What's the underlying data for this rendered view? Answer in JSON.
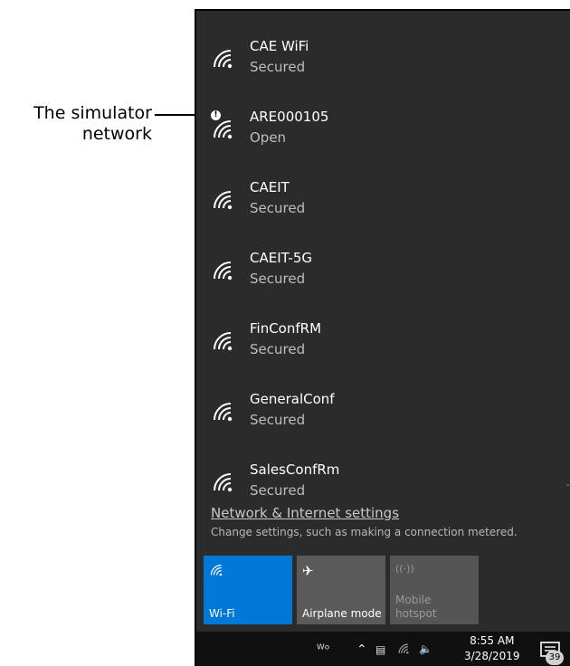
{
  "callout": {
    "line1": "The simulator",
    "line2": "network"
  },
  "networks": [
    {
      "name": "CAE WiFi",
      "status": "Secured"
    },
    {
      "name": "ARE000105",
      "status": "Open"
    },
    {
      "name": "CAEIT",
      "status": "Secured"
    },
    {
      "name": "CAEIT-5G",
      "status": "Secured"
    },
    {
      "name": "FinConfRM",
      "status": "Secured"
    },
    {
      "name": "GeneralConf",
      "status": "Secured"
    },
    {
      "name": "SalesConfRm",
      "status": "Secured"
    }
  ],
  "settings": {
    "link": "Network & Internet settings",
    "description": "Change settings, such as making a connection metered."
  },
  "quick_actions": {
    "wifi": {
      "label": "Wi-Fi",
      "icon": "wifi-icon"
    },
    "airplane": {
      "label": "Airplane mode",
      "icon": "airplane-icon"
    },
    "hotspot": {
      "label": "Mobile hotspot",
      "icon": "hotspot-icon"
    }
  },
  "taskbar": {
    "time": "8:55 AM",
    "date": "3/28/2019",
    "notification_count": "39"
  },
  "colors": {
    "flyout_bg": "#2b2b2b",
    "accent": "#0078d7",
    "taskbar_bg": "#101010"
  }
}
